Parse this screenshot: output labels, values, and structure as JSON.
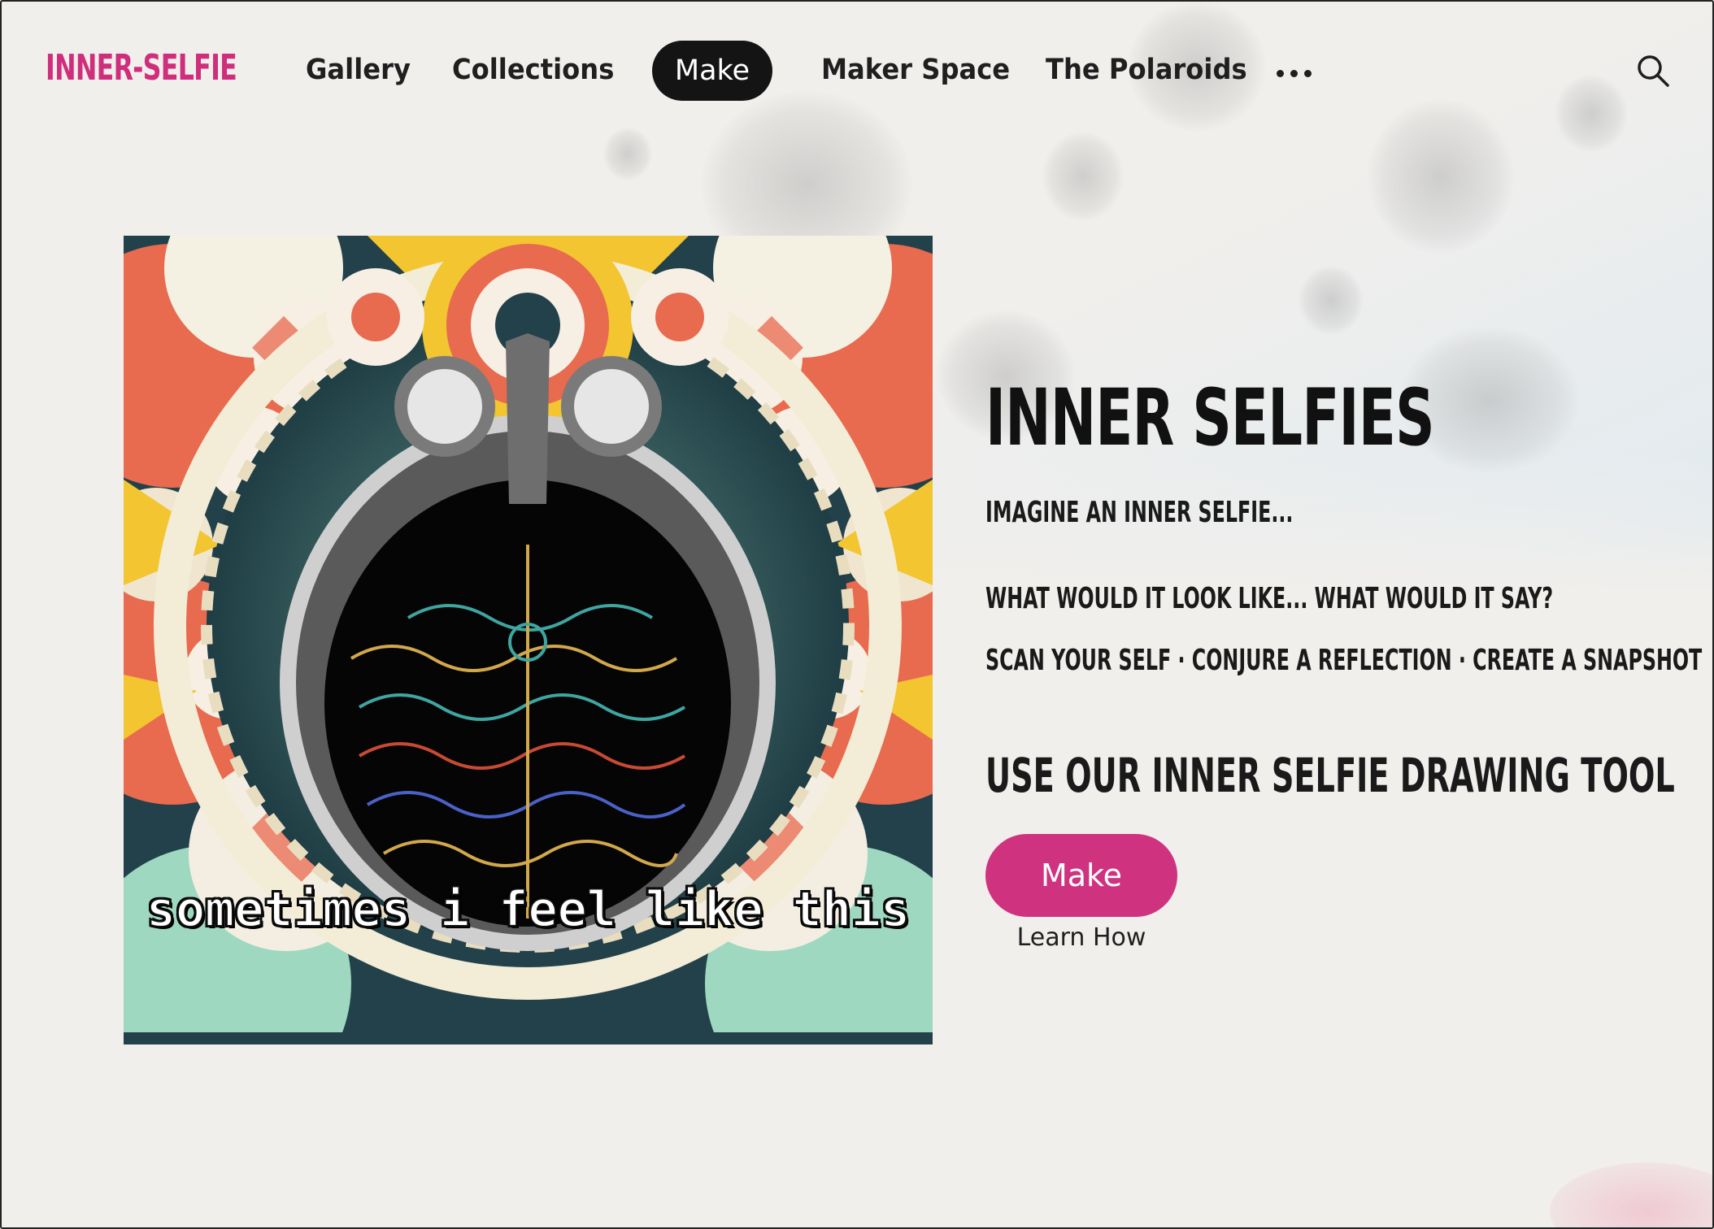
{
  "nav": {
    "logo": "INNER-SELFIE",
    "items": [
      "Gallery",
      "Collections",
      "Make",
      "Maker Space",
      "The Polaroids"
    ],
    "active": "Make",
    "more_icon": "ellipsis-icon",
    "search_icon": "search-icon"
  },
  "hero": {
    "image_caption": "sometimes i feel like this"
  },
  "content": {
    "title": "INNER SELFIES",
    "line1": "IMAGINE AN INNER SELFIE...",
    "line2": "WHAT WOULD IT LOOK LIKE... WHAT WOULD IT SAY?",
    "line3": "SCAN YOUR SELF · CONJURE A REFLECTION · CREATE A SNAPSHOT",
    "subheading": "USE OUR INNER SELFIE DRAWING TOOL",
    "make_button": "Make",
    "learn_link": "Learn How"
  },
  "colors": {
    "brand": "#cf2e7c",
    "button": "#cf3380",
    "nav_pill": "#141414"
  }
}
